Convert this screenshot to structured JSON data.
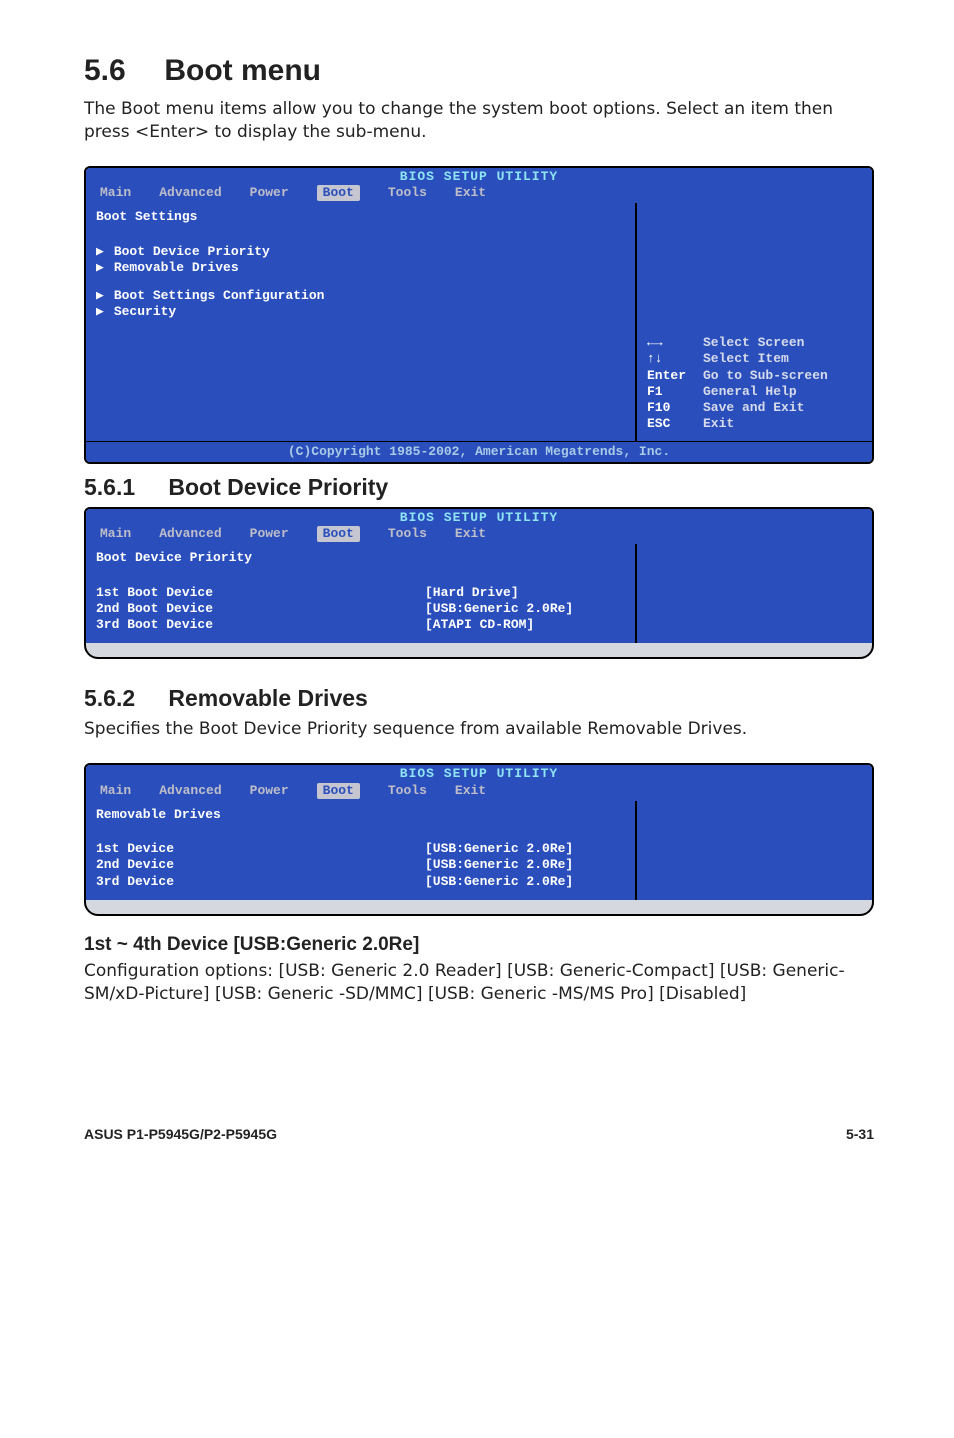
{
  "section": {
    "number": "5.6",
    "title": "Boot menu",
    "intro": "The Boot menu items allow you to change the system boot options. Select an item then press <Enter> to display the sub-menu."
  },
  "bios1": {
    "util_title": "BIOS SETUP UTILITY",
    "tabs": [
      "Main",
      "Advanced",
      "Power",
      "Boot",
      "Tools",
      "Exit"
    ],
    "panel_title": "Boot Settings",
    "items": [
      "Boot Device Priority",
      "Removable Drives",
      "Boot Settings Configuration",
      "Security"
    ],
    "hints": [
      {
        "key": "←→",
        "act": "Select Screen"
      },
      {
        "key": "↑↓",
        "act": "Select Item"
      },
      {
        "key": "Enter",
        "act": "Go to Sub-screen"
      },
      {
        "key": "F1",
        "act": "General Help"
      },
      {
        "key": "F10",
        "act": "Save and Exit"
      },
      {
        "key": "ESC",
        "act": "Exit"
      }
    ],
    "copyright": "(C)Copyright 1985-2002, American Megatrends, Inc."
  },
  "sub1": {
    "number": "5.6.1",
    "title": "Boot Device Priority"
  },
  "bios2": {
    "util_title": "BIOS SETUP UTILITY",
    "tabs": [
      "Main",
      "Advanced",
      "Power",
      "Boot",
      "Tools",
      "Exit"
    ],
    "panel_title": "Boot Device Priority",
    "rows": [
      {
        "label": "1st Boot Device",
        "value": "[Hard Drive]"
      },
      {
        "label": "2nd Boot Device",
        "value": "[USB:Generic 2.0Re]"
      },
      {
        "label": "3rd Boot Device",
        "value": "[ATAPI CD-ROM]"
      }
    ]
  },
  "sub2": {
    "number": "5.6.2",
    "title": "Removable Drives",
    "text": "Specifies the Boot Device Priority sequence from available Removable Drives."
  },
  "bios3": {
    "util_title": "BIOS SETUP UTILITY",
    "tabs": [
      "Main",
      "Advanced",
      "Power",
      "Boot",
      "Tools",
      "Exit"
    ],
    "panel_title": "Removable Drives",
    "rows": [
      {
        "label": "1st Device",
        "value": "[USB:Generic 2.0Re]"
      },
      {
        "label": "2nd Device",
        "value": "[USB:Generic 2.0Re]"
      },
      {
        "label": "3rd Device",
        "value": "[USB:Generic 2.0Re]"
      }
    ]
  },
  "opt": {
    "title": "1st ~ 4th Device [USB:Generic 2.0Re]",
    "text": "Configuration options: [USB: Generic 2.0 Reader] [USB: Generic-Compact] [USB: Generic-SM/xD-Picture] [USB: Generic -SD/MMC] [USB: Generic -MS/MS Pro] [Disabled]"
  },
  "footer": {
    "left": "ASUS P1-P5945G/P2-P5945G",
    "right": "5-31"
  }
}
